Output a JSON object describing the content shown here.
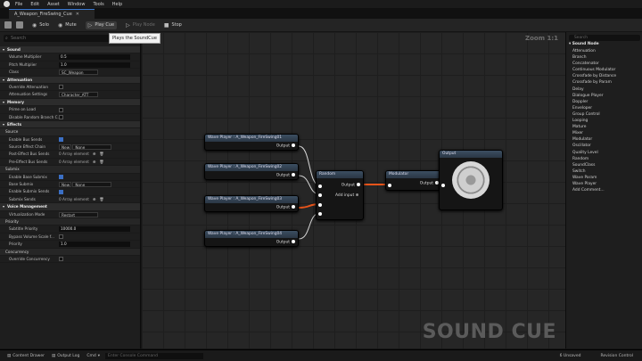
{
  "menu": [
    "File",
    "Edit",
    "Asset",
    "Window",
    "Tools",
    "Help"
  ],
  "tab": {
    "title": "A_Weapon_FireSwing_Cue"
  },
  "toolbar": {
    "save": "",
    "browse": "",
    "solo": "Solo",
    "mute": "Mute",
    "play_cue": "Play Cue",
    "play_node": "Play Node",
    "stop": "Stop"
  },
  "tooltip": "Plays the SoundCue",
  "details": {
    "search_placeholder": "Search",
    "rows": [
      {
        "kind": "section",
        "label": "Sound"
      },
      {
        "kind": "num",
        "label": "Volume Multiplier",
        "value": "0.5"
      },
      {
        "kind": "num",
        "label": "Pitch Multiplier",
        "value": "1.0"
      },
      {
        "kind": "class",
        "label": "Class",
        "value": "SC_Weapon"
      },
      {
        "kind": "section",
        "label": "Attenuation"
      },
      {
        "kind": "check",
        "label": "Override Attenuation",
        "on": false
      },
      {
        "kind": "dropdown",
        "label": "Attenuation Settings",
        "value": "Character_ATT"
      },
      {
        "kind": "section",
        "label": "Memory"
      },
      {
        "kind": "check",
        "label": "Prime on Load",
        "on": false
      },
      {
        "kind": "check",
        "label": "Disable Random Branch C...",
        "on": false
      },
      {
        "kind": "section",
        "label": "Effects"
      },
      {
        "kind": "sub",
        "label": "Source"
      },
      {
        "kind": "check",
        "label": "Enable Bus Sends",
        "on": true
      },
      {
        "kind": "dropdown2",
        "label": "Source Effect Chain",
        "value": "None",
        "btn": "New"
      },
      {
        "kind": "array",
        "label": "Post-Effect Bus Sends",
        "value": "0 Array element"
      },
      {
        "kind": "array",
        "label": "Pre-Effect Bus Sends",
        "value": "0 Array element"
      },
      {
        "kind": "sub",
        "label": "Submix"
      },
      {
        "kind": "check",
        "label": "Enable Base Submix",
        "on": true
      },
      {
        "kind": "dropdown2",
        "label": "Base Submix",
        "value": "None",
        "btn": "New"
      },
      {
        "kind": "check",
        "label": "Enable Submix Sends",
        "on": true
      },
      {
        "kind": "array",
        "label": "Submix Sends",
        "value": "0 Array element"
      },
      {
        "kind": "section",
        "label": "Voice Management"
      },
      {
        "kind": "dropdown",
        "label": "Virtualization Mode",
        "value": "Restart"
      },
      {
        "kind": "sub",
        "label": "Priority"
      },
      {
        "kind": "num",
        "label": "Subtitle Priority",
        "value": "10000.0"
      },
      {
        "kind": "check",
        "label": "Bypass Volume Scale f...",
        "on": false
      },
      {
        "kind": "num",
        "label": "Priority",
        "value": "1.0"
      },
      {
        "kind": "sub",
        "label": "Concurrency"
      },
      {
        "kind": "check",
        "label": "Override Concurrency",
        "on": false
      }
    ]
  },
  "graph": {
    "zoom": "Zoom 1:1",
    "watermark": "SOUND CUE",
    "wave_players": [
      {
        "title": "Wave Player : A_Weapon_FireSwing01",
        "pin": "Output"
      },
      {
        "title": "Wave Player : A_Weapon_FireSwing02",
        "pin": "Output"
      },
      {
        "title": "Wave Player : A_Weapon_FireSwing03",
        "pin": "Output"
      },
      {
        "title": "Wave Player : A_Weapon_FireSwing04",
        "pin": "Output"
      }
    ],
    "random": {
      "title": "Random",
      "pin": "Output",
      "add": "Add input"
    },
    "modulator": {
      "title": "Modulator",
      "pin": "Output"
    },
    "output": {
      "title": "Output"
    }
  },
  "palette": {
    "search_placeholder": "Search",
    "category": "Sound Node",
    "items": [
      "Attenuation",
      "Branch",
      "Concatenator",
      "Continuous Modulator",
      "Crossfade by Distance",
      "Crossfade by Param",
      "Delay",
      "Dialogue Player",
      "Doppler",
      "Enveloper",
      "Group Control",
      "Looping",
      "Mature",
      "Mixer",
      "Modulator",
      "Oscillator",
      "Quality Level",
      "Random",
      "SoundClass",
      "Switch",
      "Wave Param",
      "Wave Player",
      "Add Comment..."
    ]
  },
  "status": {
    "content_drawer": "Content Drawer",
    "output_log": "Output Log",
    "cmd": "Cmd",
    "cmd_placeholder": "Enter Console Command",
    "unsaved": "6 Unsaved",
    "revision": "Revision Control"
  },
  "colors": {
    "accent": "#3a7bd5",
    "wire_active": "#e8541a"
  }
}
